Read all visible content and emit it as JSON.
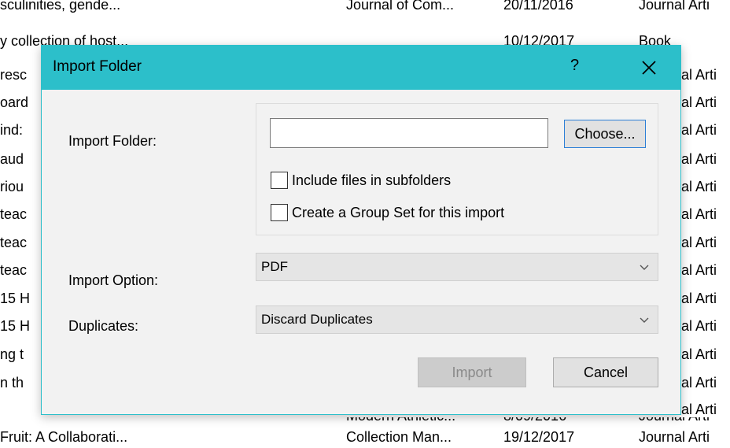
{
  "background": {
    "top_rows": [
      {
        "title": "sculinities, gende...",
        "source": "Journal of Com...",
        "date": "20/11/2016",
        "type": "Journal Arti"
      },
      {
        "title": "y collection of host...",
        "source": "",
        "date": "10/12/2017",
        "type": "Book"
      }
    ],
    "left_fragments": [
      "resc",
      "oard",
      "ind:",
      "aud",
      "riou",
      "teac",
      "teac",
      "teac",
      "15 H",
      "15 H",
      "ng t",
      "n th"
    ],
    "right_fragments": [
      "al Arti",
      "al Arti",
      "al Arti",
      "al Arti",
      "al Arti",
      "al Arti",
      "al Arti",
      "al Arti",
      "al Arti",
      "al Arti",
      "al Arti",
      "al Arti",
      "al Arti",
      "al Arti"
    ],
    "bottom_row": {
      "title": "Fruit: A Collaborati...",
      "source": "Collection Man...",
      "date": "19/12/2017",
      "type": "Journal Arti"
    },
    "partial_row": {
      "source": "Modern Athletic...",
      "date": "8/09/2016",
      "type": "Journal Arti"
    }
  },
  "dialog": {
    "title": "Import Folder",
    "help_label": "?",
    "import_folder_label": "Import Folder:",
    "folder_value": "",
    "choose_label": "Choose...",
    "include_subfolders_label": "Include files in subfolders",
    "include_subfolders_checked": false,
    "create_group_set_label": "Create a Group Set for this import",
    "create_group_set_checked": false,
    "import_option_label": "Import Option:",
    "import_option_value": "PDF",
    "duplicates_label": "Duplicates:",
    "duplicates_value": "Discard Duplicates",
    "import_button": "Import",
    "cancel_button": "Cancel",
    "accent_color": "#2cbfca"
  }
}
